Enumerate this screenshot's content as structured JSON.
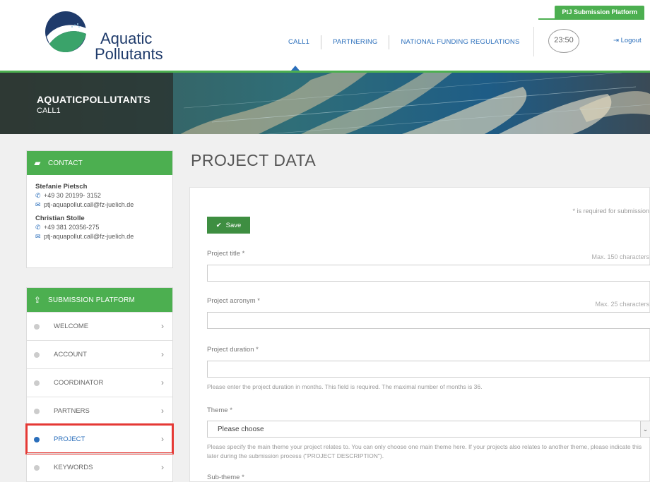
{
  "header": {
    "platform_label": "PtJ Submission Platform",
    "logo_word1": "Aquatic",
    "logo_word2": "Pollutants",
    "nav": [
      {
        "label": "CALL1"
      },
      {
        "label": "PARTNERING"
      },
      {
        "label": "NATIONAL FUNDING REGULATIONS"
      }
    ],
    "timer": "23:50",
    "logout_label": "Logout",
    "colors": {
      "accent_green": "#4caf50",
      "link_blue": "#2a6ebb",
      "logo_navy": "#1f3b6b"
    }
  },
  "banner": {
    "title": "AQUATICPOLLUTANTS",
    "subtitle": "CALL1"
  },
  "contact": {
    "heading": "CONTACT",
    "icon": "chat-icon",
    "people": [
      {
        "name": "Stefanie Pietsch",
        "phone": "+49 30 20199- 3152",
        "email": "ptj-aquapollut.call@fz-juelich.de"
      },
      {
        "name": "Christian Stolle",
        "phone": "+49 381 20356-275",
        "email": "ptj-aquapollut.call@fz-juelich.de"
      }
    ]
  },
  "submission": {
    "heading": "SUBMISSION PLATFORM",
    "icon": "upload-icon",
    "items": [
      {
        "label": "WELCOME",
        "active": false
      },
      {
        "label": "ACCOUNT",
        "active": false
      },
      {
        "label": "COORDINATOR",
        "active": false
      },
      {
        "label": "PARTNERS",
        "active": false
      },
      {
        "label": "PROJECT",
        "active": true
      },
      {
        "label": "KEYWORDS",
        "active": false
      }
    ]
  },
  "main": {
    "title": "PROJECT DATA",
    "required_note": "* is required for submission",
    "save_label": "Save",
    "fields": {
      "title": {
        "label": "Project title *",
        "hint": "Max. 150 characters",
        "value": ""
      },
      "acronym": {
        "label": "Project acronym *",
        "hint": "Max. 25 characters",
        "value": ""
      },
      "duration": {
        "label": "Project duration *",
        "value": "",
        "help": "Please enter the project duration in months. This field is required. The maximal number of months is 36."
      },
      "theme": {
        "label": "Theme *",
        "selected": "Please choose",
        "help": "Please specify the main theme your project relates to. You can only choose one main theme here. If your projects also relates to another theme, please indicate this later during the submission process (\"PROJECT DESCRIPTION\")."
      },
      "subtheme": {
        "label": "Sub-theme *"
      }
    }
  }
}
